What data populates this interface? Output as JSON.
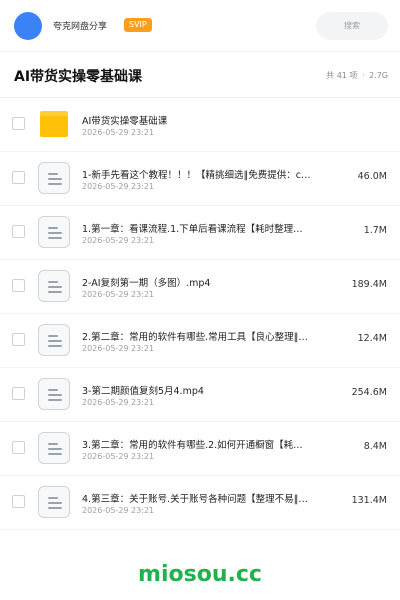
{
  "header": {
    "username": "夸克网盘分享",
    "badge": "SVIP",
    "search_label": "搜索"
  },
  "title": "AI带货实操零基础课",
  "summary": {
    "count": "共 41 项",
    "sep": "·",
    "size": "2.7G"
  },
  "files": [
    {
      "type": "folder",
      "name": "AI带货实操零基础课",
      "date": "2026-05-29 23:21",
      "size": ""
    },
    {
      "type": "file",
      "name": "1-新手先看这个教程！！！【精挑细选‖免费提供：c…",
      "date": "2026-05-29 23:21",
      "size": "46.0M"
    },
    {
      "type": "file",
      "name": "1.第一章：看课流程.1.下单后看课流程【耗时整理…",
      "date": "2026-05-29 23:21",
      "size": "1.7M"
    },
    {
      "type": "file",
      "name": "2-AI复刻第一期（多图）.mp4",
      "date": "2026-05-29 23:21",
      "size": "189.4M"
    },
    {
      "type": "file",
      "name": "2.第二章：常用的软件有哪些.常用工具【良心整理‖…",
      "date": "2026-05-29 23:21",
      "size": "12.4M"
    },
    {
      "type": "file",
      "name": "3-第二期颜值复刻5月4.mp4",
      "date": "2026-05-29 23:21",
      "size": "254.6M"
    },
    {
      "type": "file",
      "name": "3.第二章：常用的软件有哪些.2.如何开通橱窗【耗…",
      "date": "2026-05-29 23:21",
      "size": "8.4M"
    },
    {
      "type": "file",
      "name": "4.第三章：关于账号.关于账号各种问题【整理不易‖…",
      "date": "2026-05-29 23:21",
      "size": "131.4M"
    }
  ],
  "watermark": "miosou.cc"
}
